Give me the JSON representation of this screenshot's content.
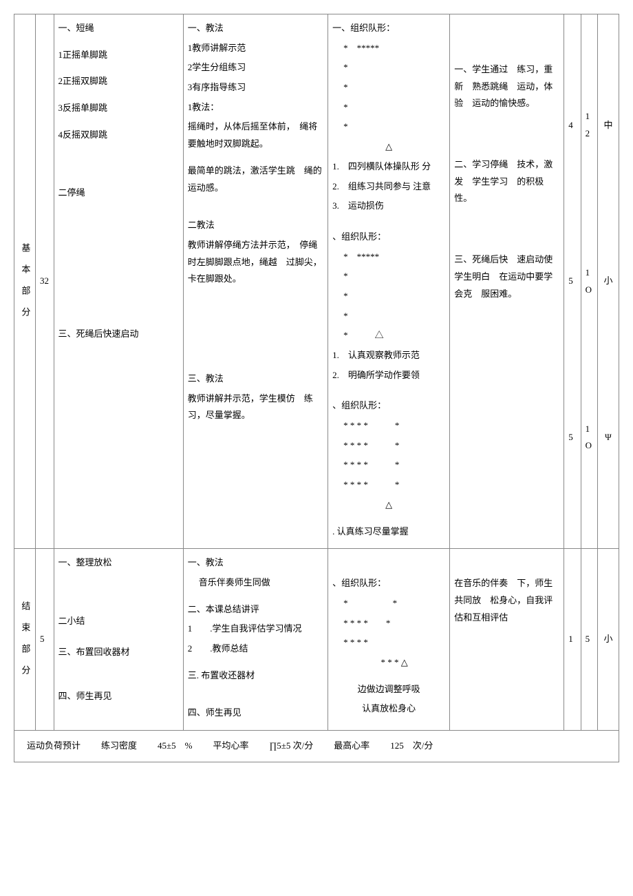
{
  "main": {
    "label": "基本部分",
    "time": "32",
    "col1": {
      "h1": "一、短绳",
      "i1": "1正摇单脚跳",
      "i2": "2正摇双脚跳",
      "i3": "3反摇单脚跳",
      "i4": "4反摇双脚跳",
      "h2": "二停绳",
      "h3": "三、死绳后快速启动"
    },
    "col2": {
      "h1": "一、教法",
      "l1": "1教师讲解示范",
      "l2": "2学生分组练习",
      "l3": "3有序指导练习",
      "l4": "1教法：",
      "p1": "摇绳时，从体后摇至体前，　绳将要触地时双脚跳起。",
      "p2": "最简单的跳法，激活学生跳　绳的运动感。",
      "h2": "二教法",
      "p3": "教师讲解停绳方法并示范，　停绳时左脚脚跟点地，绳越　过脚尖，卡在脚跟处。",
      "h3": "三、教法",
      "p4": "教师讲解并示范，学生模仿　练习，尽量掌握。"
    },
    "col3": {
      "h1": "一、组织队形：",
      "f1a": "*　*****",
      "f1b": "*",
      "f1c": "*",
      "f1d": "*",
      "f1e": "*",
      "tri1": "△",
      "n1": "1.　四列横队体操队形 分",
      "n2": "2.　组练习共同参与 注意",
      "n3": "3.　运动损伤",
      "h2": "、组织队形：",
      "f2a": "*　*****",
      "f2b": "*",
      "f2c": "*",
      "f2d": "*",
      "f2e": "*　　　△",
      "n4": "1.　认真观察教师示范",
      "n5": "2.　明确所学动作要领",
      "h3": "、组织队形：",
      "f3a": "* * * *　　　*",
      "f3b": "* * * *　　　*",
      "f3c": "* * * *　　　*",
      "f3d": "* * * *　　　*",
      "tri3": "△",
      "n6": ". 认真练习尽量掌握"
    },
    "col4": {
      "p1": "一、学生通过　练习，重新　熟悉跳绳　运动，体验　运动的愉快感。",
      "p2": "二、学习停绳　技术，激发　学生学习　的积极性。",
      "p3": "三、死绳后快　速启动使　学生明白　在运动中要学会克　服困难。"
    },
    "times": {
      "t1": "4",
      "t2": "5",
      "t3": "5"
    },
    "counts": {
      "c1": "12",
      "c2": "1O",
      "c3": "1O"
    },
    "intensity": {
      "i1": "中",
      "i2": "小",
      "i3": "Ψ"
    }
  },
  "end": {
    "label": "结束部分",
    "time": "5",
    "col1": {
      "l1": "一、整理放松",
      "l2": "二小结",
      "l3": "三、布置回收器材",
      "l4": "四、师生再见"
    },
    "col2": {
      "h1": "一、教法",
      "p1": "音乐伴奏师生同做",
      "h2": "二、本课总结讲评",
      "p2": "1　　.学生自我评估学习情况",
      "p3": "2　　.教师总结",
      "h3": "三. 布置收还器材",
      "h4": "四、师生再见"
    },
    "col3": {
      "h1": "、组织队形：",
      "f1": "*　　　　　*",
      "f2": "* * * *　　*",
      "f3": "* * * *",
      "f4": "* * * △",
      "n1": "边做边调整呼吸",
      "n2": "认真放松身心"
    },
    "col4": {
      "p1": "在音乐的伴奏　下，师生共同放　松身心，自我评　估和互相评估"
    },
    "times": "1",
    "counts": "5",
    "intensity": "小"
  },
  "footer": {
    "label": "运动负荷预计",
    "density_label": "练习密度",
    "density_value": "45±5　%",
    "avg_hr_label": "平均心率",
    "avg_hr_value": "∏5±5 次/分",
    "max_hr_label": "最高心率",
    "max_hr_value": "125　次/分"
  }
}
